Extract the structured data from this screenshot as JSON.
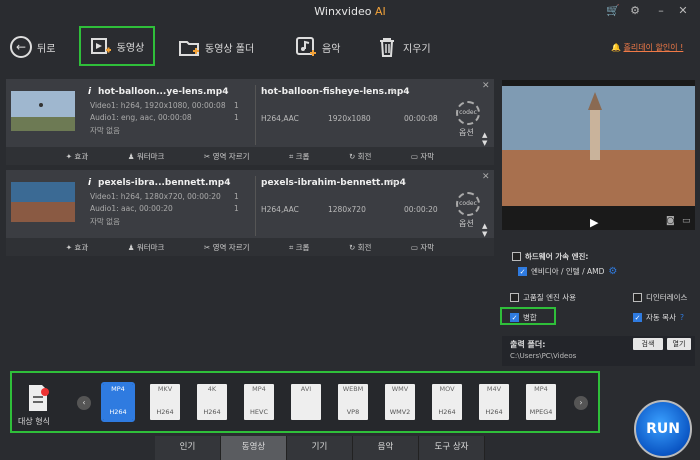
{
  "app": {
    "title": "Winxvideo",
    "title_ai": "AI"
  },
  "toolbar": {
    "back": "뒤로",
    "video": "동영상",
    "video_folder": "동영상 폴더",
    "music": "음악",
    "delete": "지우기",
    "promo": "홀리데이 할인이 !"
  },
  "files": [
    {
      "input_name": "hot-balloon...ye-lens.mp4",
      "video": "Video1: h264, 1920x1080, 00:00:08",
      "audio": "Audio1: eng, aac, 00:00:08",
      "subtitle": "자막 없음",
      "output_name": "hot-balloon-fisheye-lens.mp4",
      "codec": "H264,AAC",
      "resolution": "1920x1080",
      "duration": "00:00:08",
      "video_count": "1",
      "audio_count": "1"
    },
    {
      "input_name": "pexels-ibra...bennett.mp4",
      "video": "Video1: h264, 1280x720, 00:00:20",
      "audio": "Audio1: aac, 00:00:20",
      "subtitle": "자막 없음",
      "output_name": "pexels-ibrahim-bennett.mp4",
      "codec": "H264,AAC",
      "resolution": "1280x720",
      "duration": "00:00:20",
      "video_count": "1",
      "audio_count": "1"
    }
  ],
  "actions": [
    "효과",
    "워터마크",
    "영역 자르기",
    "크롭",
    "회전",
    "자막"
  ],
  "options_label": "옵션",
  "codec_badge": "codec",
  "settings": {
    "hw": "하드웨어 가속 엔진:",
    "hw_vendor": "엔비디아 / 인텔 / AMD",
    "hq": "고품질 엔진 사용",
    "deinterlace": "디인터레이스",
    "merge": "병합",
    "auto_copy": "자동 복사",
    "auto_copy_help": "?"
  },
  "output": {
    "label": "출력 폴더:",
    "path": "C:\\Users\\PC\\Videos",
    "browse": "검색",
    "open": "열기"
  },
  "formats": {
    "target_label": "대상 형식",
    "items": [
      {
        "top": "MP4",
        "bottom": "H264",
        "selected": true
      },
      {
        "top": "MKV",
        "bottom": "H264",
        "selected": false
      },
      {
        "top": "4K",
        "bottom": "H264",
        "selected": false
      },
      {
        "top": "MP4",
        "bottom": "HEVC",
        "selected": false
      },
      {
        "top": "AVI",
        "bottom": "",
        "selected": false
      },
      {
        "top": "WEBM",
        "bottom": "VP8",
        "selected": false
      },
      {
        "top": "WMV",
        "bottom": "WMV2",
        "selected": false
      },
      {
        "top": "MOV",
        "bottom": "H264",
        "selected": false
      },
      {
        "top": "M4V",
        "bottom": "H264",
        "selected": false
      },
      {
        "top": "MP4",
        "bottom": "MPEG4",
        "selected": false
      }
    ]
  },
  "bottom_tabs": [
    "인기",
    "동영상",
    "기기",
    "음악",
    "도구 상자"
  ],
  "run": "RUN",
  "colors": {
    "accent": "#2f7be0",
    "highlight": "#2fbf3a",
    "promo": "#f07a47"
  }
}
